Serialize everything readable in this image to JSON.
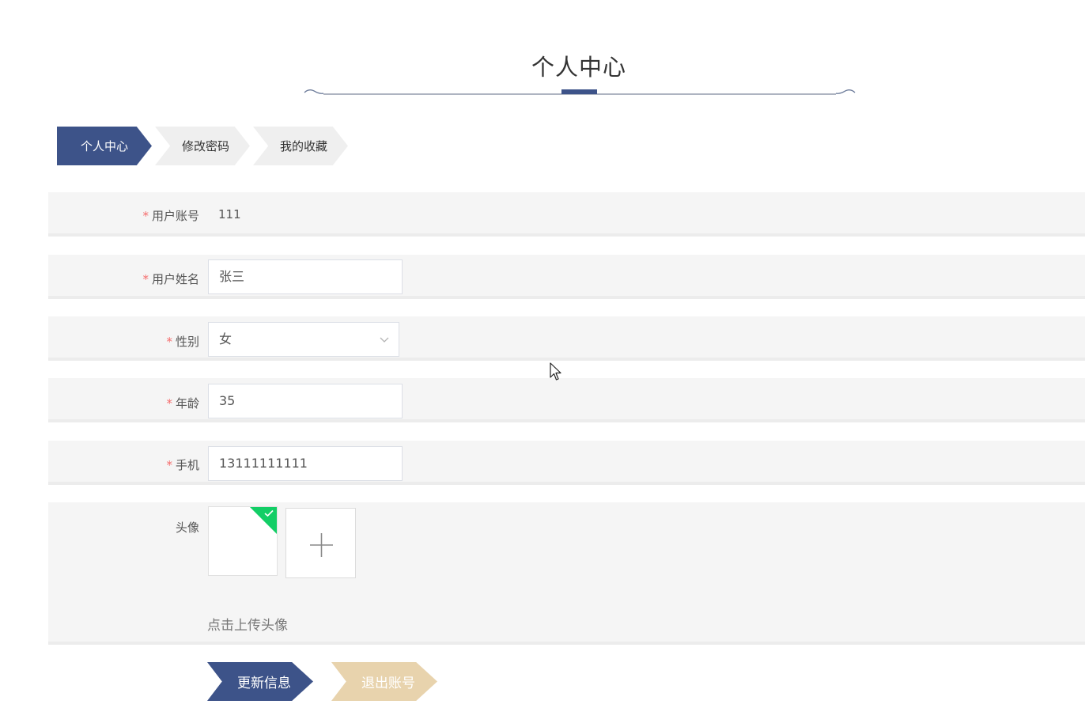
{
  "page": {
    "title": "个人中心"
  },
  "tabs": [
    {
      "label": "个人中心",
      "active": true
    },
    {
      "label": "修改密码",
      "active": false
    },
    {
      "label": "我的收藏",
      "active": false
    }
  ],
  "form": {
    "account": {
      "label": "用户账号",
      "required_mark": "*",
      "value": "111"
    },
    "name": {
      "label": "用户姓名",
      "required_mark": "*",
      "value": "张三"
    },
    "gender": {
      "label": "性别",
      "required_mark": "*",
      "value": "女"
    },
    "age": {
      "label": "年龄",
      "required_mark": "*",
      "value": "35"
    },
    "phone": {
      "label": "手机",
      "required_mark": "*",
      "value": "13111111111"
    },
    "avatar": {
      "label": "头像",
      "hint": "点击上传头像"
    }
  },
  "actions": {
    "update_label": "更新信息",
    "logout_label": "退出账号"
  },
  "icons": {
    "chevron": "chevron-down-icon",
    "plus": "plus-icon",
    "check": "check-icon",
    "cursor": "mouse-cursor-icon"
  },
  "colors": {
    "primary": "#3d5389",
    "logout": "#e8d3ad",
    "required": "#f56c6c",
    "success": "#13ce66",
    "row_bg": "#f5f5f5"
  }
}
